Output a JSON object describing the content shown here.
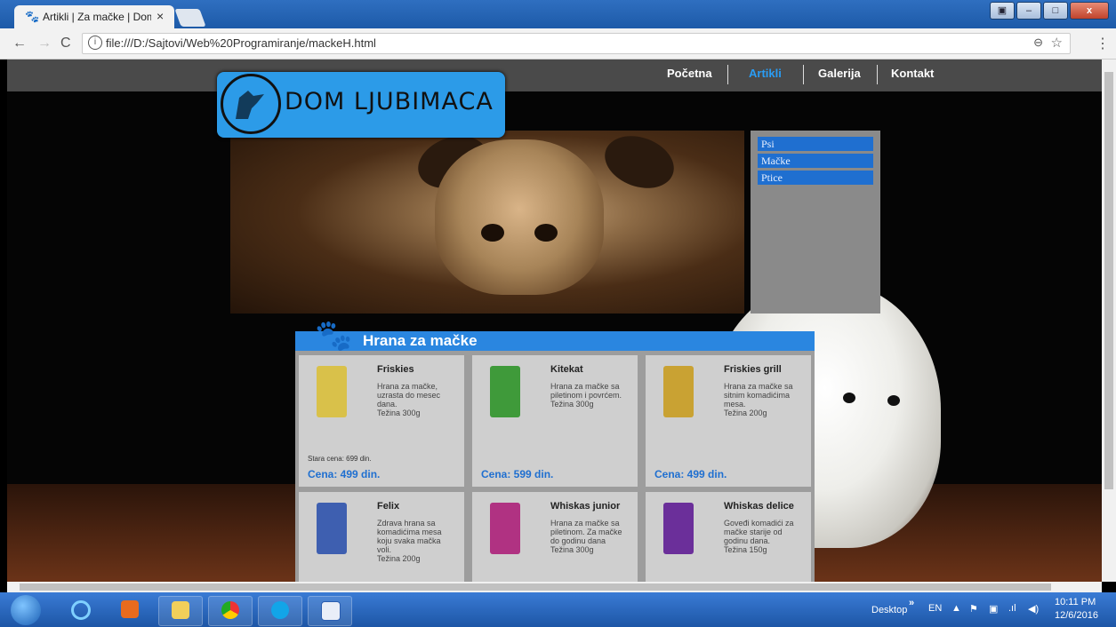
{
  "browser": {
    "tab_title": "Artikli | Za mačke | Dom l",
    "url": "file:///D:/Sajtovi/Web%20Programiranje/mackeH.html"
  },
  "nav": {
    "items": [
      {
        "label": "Početna"
      },
      {
        "label": "Artikli"
      },
      {
        "label": "Galerija"
      },
      {
        "label": "Kontakt"
      }
    ]
  },
  "logo": {
    "text": "DOM LJUBIMACA"
  },
  "side_menu": {
    "items": [
      {
        "label": "Psi"
      },
      {
        "label": "Mačke"
      },
      {
        "label": "Ptice"
      }
    ]
  },
  "section": {
    "title": "Hrana za mačke"
  },
  "products": [
    {
      "name": "Friskies",
      "desc": "Hrana za mačke, uzrasta do mesec dana.",
      "weight": "Težina 300g",
      "old_price": "Stara cena: 699 din.",
      "price": "Cena: 499 din.",
      "color": "#d9c14a"
    },
    {
      "name": "Kitekat",
      "desc": "Hrana za mačke sa piletinom i povrćem.",
      "weight": "Težina 300g",
      "old_price": "",
      "price": "Cena: 599 din.",
      "color": "#3f9a3a"
    },
    {
      "name": "Friskies grill",
      "desc": "Hrana za mačke sa sitnim komadićima mesa.",
      "weight": "Težina 200g",
      "old_price": "",
      "price": "Cena: 499 din.",
      "color": "#c9a233"
    },
    {
      "name": "Felix",
      "desc": "Zdrava hrana sa komadićima mesa koju svaka mačka voli.",
      "weight": "Težina 200g",
      "old_price": "",
      "price": "",
      "color": "#3e5fb0"
    },
    {
      "name": "Whiskas junior",
      "desc": "Hrana za mačke sa piletinom. Za mačke do godinu dana",
      "weight": "Težina 300g",
      "old_price": "",
      "price": "",
      "color": "#b03282"
    },
    {
      "name": "Whiskas delice",
      "desc": "Goveđi komadići za mačke starije od godinu dana.",
      "weight": "Težina 150g",
      "old_price": "",
      "price": "",
      "color": "#6b2f9a"
    }
  ],
  "taskbar": {
    "desktop_label": "Desktop",
    "lang": "EN",
    "time": "10:11 PM",
    "date": "12/6/2016"
  }
}
